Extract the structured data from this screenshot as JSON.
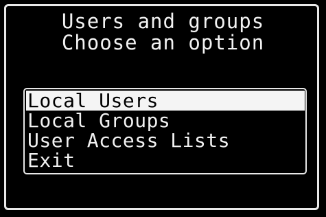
{
  "header": {
    "title": "Users and groups",
    "subtitle": "Choose an option"
  },
  "menu": {
    "selected_index": 0,
    "items": [
      {
        "label": "Local Users"
      },
      {
        "label": "Local Groups"
      },
      {
        "label": "User Access Lists"
      },
      {
        "label": "Exit"
      }
    ]
  },
  "colors": {
    "background": "#000000",
    "foreground": "#f2f2f2",
    "highlight_background": "#f4f4f4",
    "highlight_text": "#000000"
  }
}
